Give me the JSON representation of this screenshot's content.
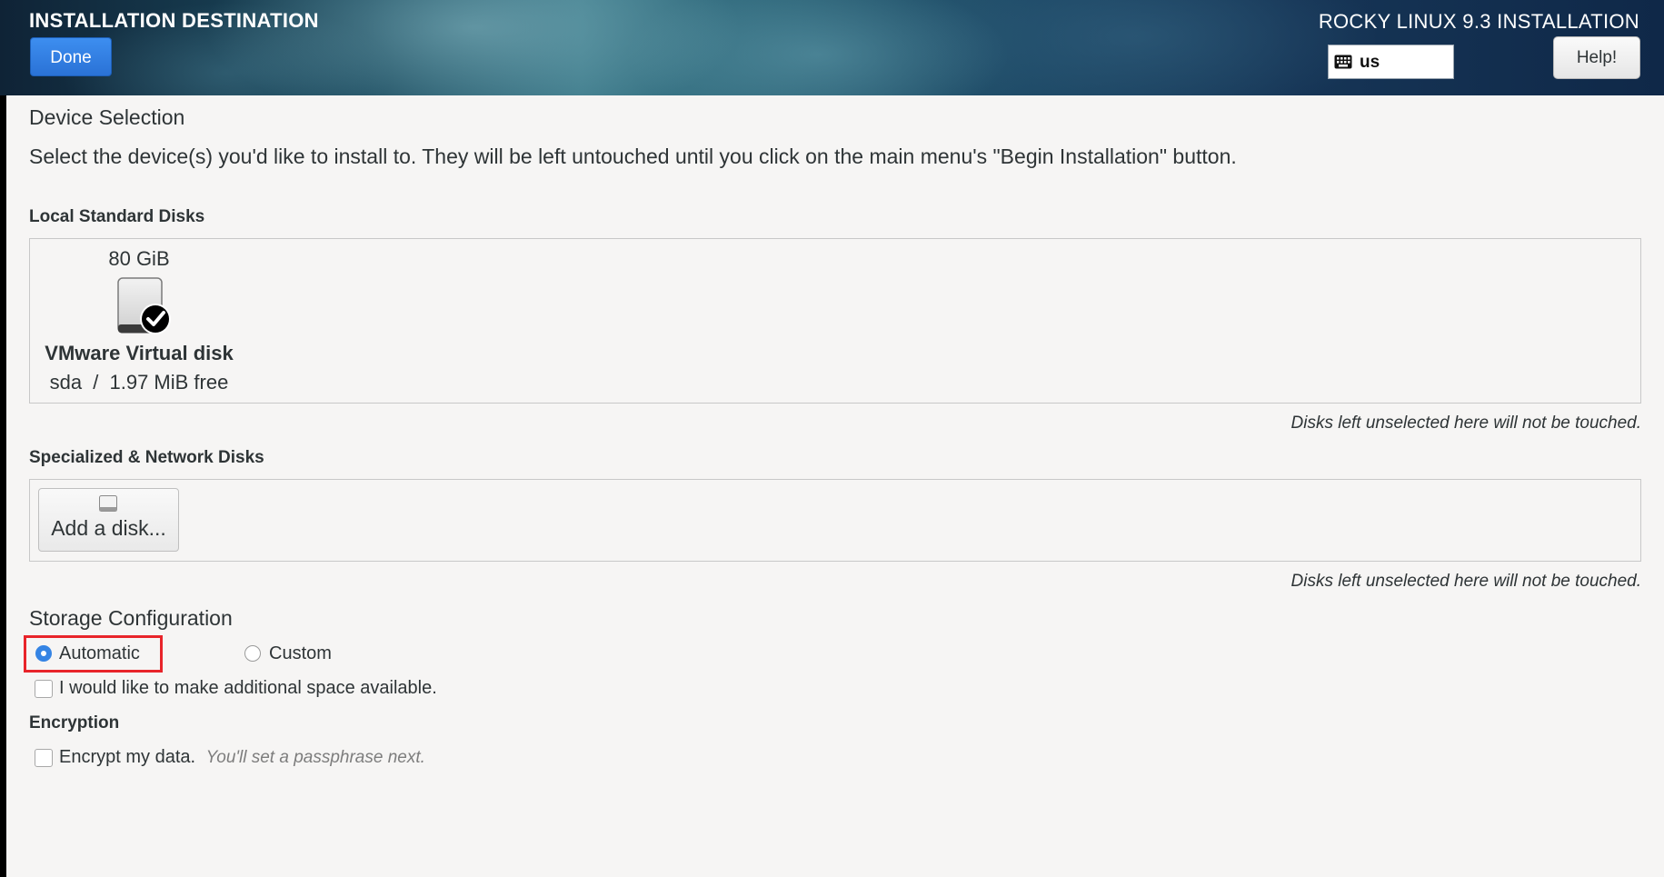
{
  "header": {
    "title": "INSTALLATION DESTINATION",
    "done_label": "Done",
    "product": "ROCKY LINUX 9.3 INSTALLATION",
    "keyboard_layout": "us",
    "help_label": "Help!"
  },
  "device_selection": {
    "heading": "Device Selection",
    "description": "Select the device(s) you'd like to install to.  They will be left untouched until you click on the main menu's \"Begin Installation\" button."
  },
  "local_disks": {
    "label": "Local Standard Disks",
    "disks": [
      {
        "size": "80 GiB",
        "name": "VMware Virtual disk",
        "device": "sda",
        "separator": "/",
        "free": "1.97 MiB free",
        "selected": true
      }
    ],
    "note": "Disks left unselected here will not be touched."
  },
  "network_disks": {
    "label": "Specialized & Network Disks",
    "add_label": "Add a disk...",
    "note": "Disks left unselected here will not be touched."
  },
  "storage_config": {
    "heading": "Storage Configuration",
    "options": [
      {
        "label": "Automatic",
        "selected": true
      },
      {
        "label": "Custom",
        "selected": false
      }
    ],
    "additional_space_label": "I would like to make additional space available.",
    "additional_space_checked": false
  },
  "encryption": {
    "heading": "Encryption",
    "encrypt_label": "Encrypt my data.",
    "encrypt_hint": "You'll set a passphrase next.",
    "encrypt_checked": false
  },
  "colors": {
    "accent": "#3584e4",
    "highlight": "#e8242a",
    "background": "#f6f5f4"
  }
}
